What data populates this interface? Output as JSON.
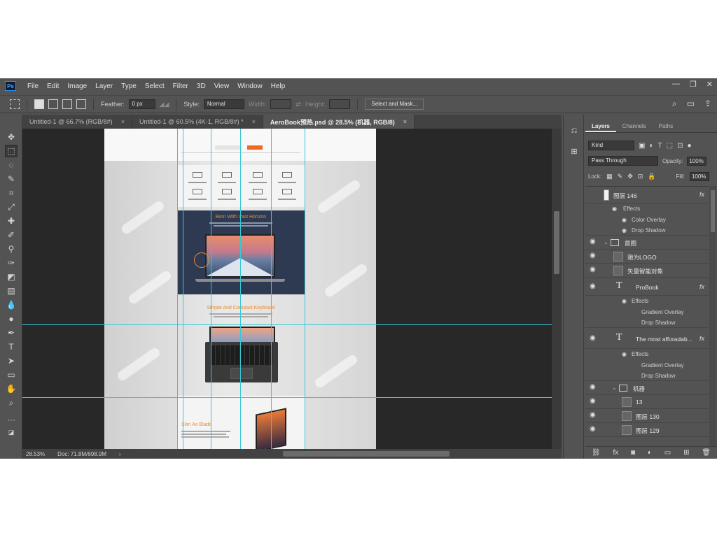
{
  "menubar": {
    "logo": "Ps",
    "items": [
      "File",
      "Edit",
      "Image",
      "Layer",
      "Type",
      "Select",
      "Filter",
      "3D",
      "View",
      "Window",
      "Help"
    ],
    "window_controls": [
      "—",
      "❐",
      "✕"
    ]
  },
  "options": {
    "feather_label": "Feather:",
    "feather_value": "0 px",
    "style_label": "Style:",
    "style_value": "Normal",
    "width_label": "Width:",
    "height_label": "Height:",
    "select_mask": "Select and Mask..."
  },
  "tabs": [
    {
      "label": "Untitled-1 @ 66.7% (RGB/8#)",
      "close": "×"
    },
    {
      "label": "Untitled-1 @ 60.5% (4K-1, RGB/8#) *",
      "close": "×"
    },
    {
      "label": "AeroBook预热.psd @ 28.5% (机器, RGB/8)",
      "close": "×"
    }
  ],
  "canvas": {
    "hero_title": "Born With Vast Horizon",
    "keyboard_title": "Simple And Compact Keyboard",
    "slim_title": "Slim As Blade"
  },
  "status": {
    "zoom": "28.53%",
    "doc": "Doc: 71.8M/698.9M",
    "arrow": "›"
  },
  "layers_panel": {
    "tabs": [
      "Layers",
      "Channels",
      "Paths"
    ],
    "kind": "Kind",
    "blend_mode": "Pass Through",
    "opacity_label": "Opacity:",
    "opacity": "100%",
    "lock_label": "Lock:",
    "fill_label": "Fill:",
    "fill": "100%",
    "layers": {
      "l146": "图层 146",
      "effects": "Effects",
      "color_overlay": "Color Overlay",
      "drop_shadow": "Drop Shadow",
      "gradient_overlay": "Gradient Overlay",
      "group_shoutu": "首图",
      "huawei_logo": "驰为LOGO",
      "vector_smart": "矢量智能对象",
      "probook": "ProBook",
      "most_affordable": "The most afforadab...",
      "group_jiqi": "机器",
      "l13": "13",
      "l130": "图层 130",
      "l129": "图层 129"
    }
  },
  "colors": {
    "app_bg": "#535353",
    "canvas_bg": "#282828",
    "guide": "#35c9d6",
    "accent_orange": "#ef8a2e"
  }
}
